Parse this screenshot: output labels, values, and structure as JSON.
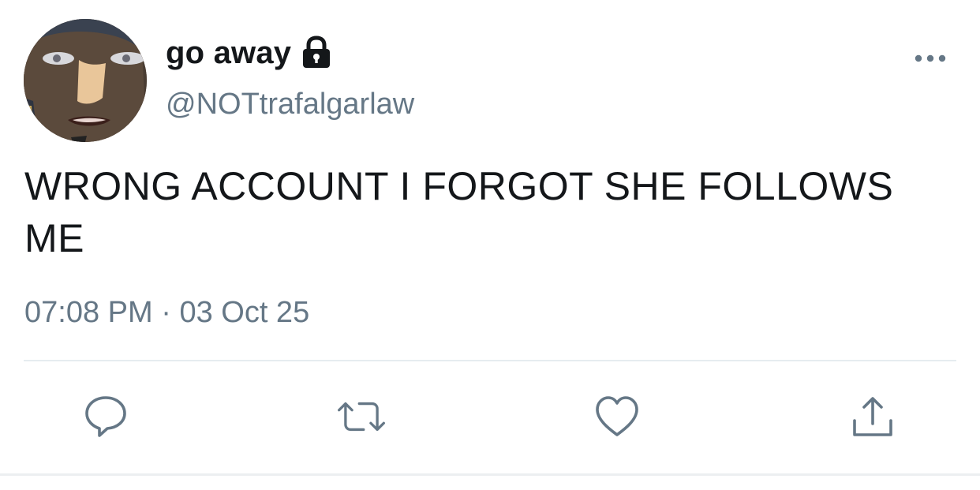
{
  "tweet": {
    "display_name": "go away",
    "handle": "@NOTtrafalgarlaw",
    "text": "WRONG ACCOUNT I FORGOT SHE FOLLOWS ME",
    "time": "07:08 PM",
    "separator": "·",
    "date": "03 Oct 25",
    "protected": true
  },
  "icons": {
    "lock": "lock-icon",
    "more": "more-icon",
    "reply": "reply-icon",
    "retweet": "retweet-icon",
    "like": "heart-icon",
    "share": "share-icon"
  },
  "colors": {
    "text_primary": "#14171a",
    "text_secondary": "#657786",
    "icon": "#657786",
    "divider": "#e6ecf0"
  }
}
